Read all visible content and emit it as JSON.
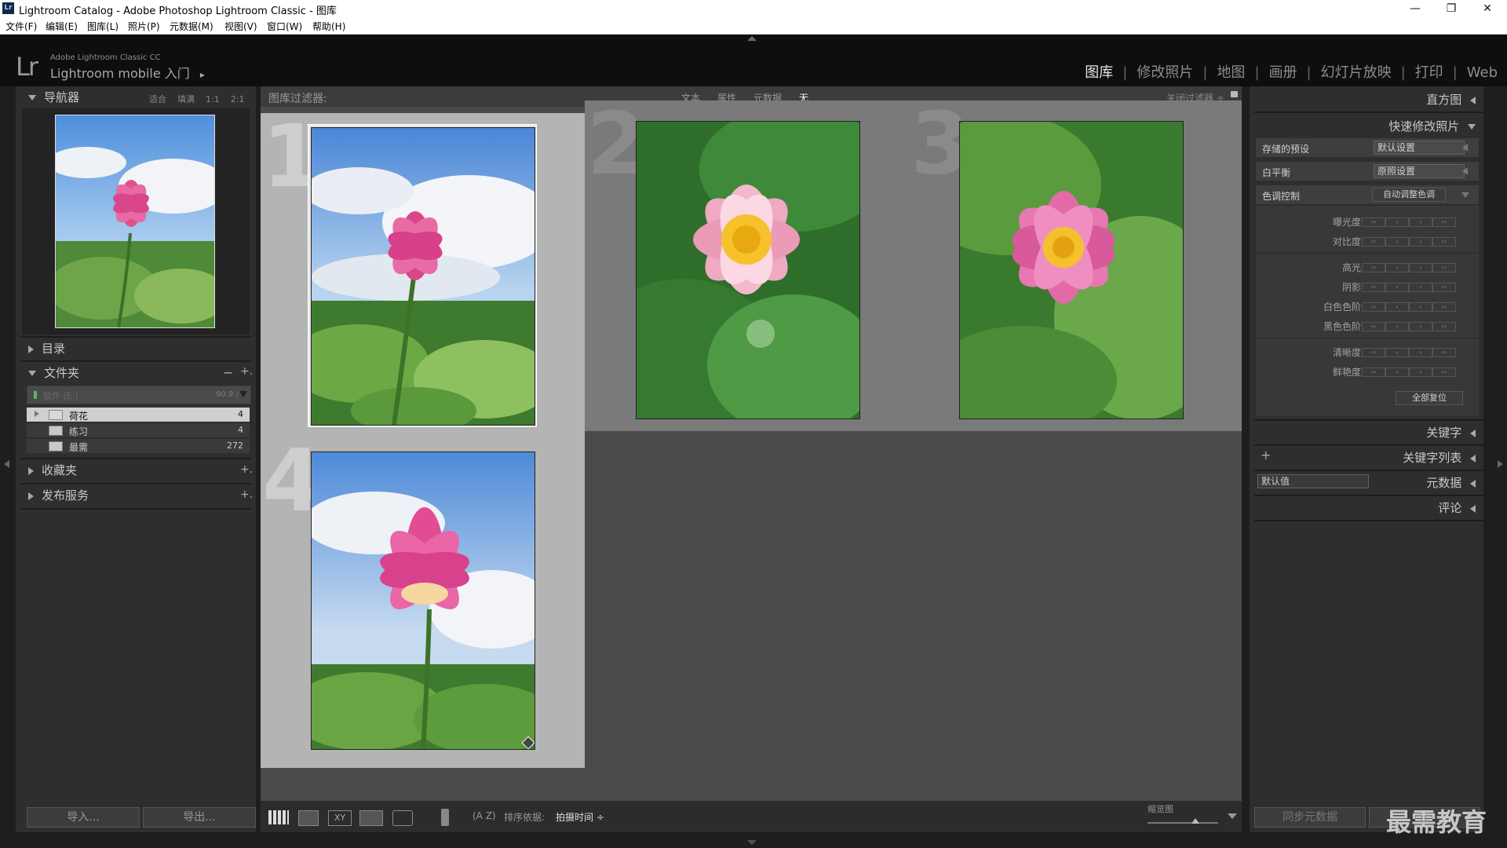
{
  "window": {
    "title": "Lightroom Catalog - Adobe Photoshop Lightroom Classic - 图库",
    "app_badge": "Lr",
    "minimize": "—",
    "restore": "❐",
    "close": "✕"
  },
  "menu": [
    "文件(F)",
    "编辑(E)",
    "图库(L)",
    "照片(P)",
    "元数据(M)",
    "视图(V)",
    "窗口(W)",
    "帮助(H)"
  ],
  "identity": {
    "logo": "Lr",
    "product": "Adobe Lightroom Classic CC",
    "mobile": "Lightroom mobile 入门",
    "arrow": "▸"
  },
  "modules": [
    {
      "label": "图库",
      "active": true
    },
    {
      "label": "修改照片",
      "active": false
    },
    {
      "label": "地图",
      "active": false
    },
    {
      "label": "画册",
      "active": false
    },
    {
      "label": "幻灯片放映",
      "active": false
    },
    {
      "label": "打印",
      "active": false
    },
    {
      "label": "Web",
      "active": false
    }
  ],
  "left": {
    "navigator": {
      "title": "导航器",
      "fit": "适合",
      "fill": "填满",
      "one": "1:1",
      "two": "2:1",
      "updown": "÷"
    },
    "catalog": "目录",
    "folders": {
      "title": "文件夹",
      "minus": "−",
      "plus": "+.",
      "volume": "软件 (E:)",
      "volume_size": "90.9 /",
      "items": [
        {
          "name": "荷花",
          "count": "4",
          "selected": true
        },
        {
          "name": "练习",
          "count": "4",
          "selected": false
        },
        {
          "name": "最需",
          "count": "272",
          "selected": false
        }
      ]
    },
    "collections": "收藏夹",
    "publish": "发布服务",
    "import": "导入...",
    "export": "导出..."
  },
  "filterbar": {
    "label": "图库过滤器:",
    "text": "文本",
    "attr": "属性",
    "meta": "元数据",
    "none": "无",
    "close": "关闭过滤器 ÷"
  },
  "cells": [
    {
      "num": "1"
    },
    {
      "num": "2"
    },
    {
      "num": "3"
    },
    {
      "num": "4"
    }
  ],
  "toolbar": {
    "sort_icon": "(A Z)",
    "sort_label": "排序依据:",
    "sort_value": "拍摄时间 ÷",
    "thumb_label": "缩览图"
  },
  "right": {
    "histogram": "直方图",
    "quick_develop": "快速修改照片",
    "saved_preset": "存储的预设",
    "saved_preset_value": "默认设置",
    "white_balance": "白平衡",
    "white_balance_value": "原照设置",
    "tone_control": "色调控制",
    "auto_tone": "自动调整色调",
    "rows": [
      "曝光度",
      "对比度",
      "高光",
      "阴影",
      "白色色阶",
      "黑色色阶",
      "清晰度",
      "鲜艳度"
    ],
    "btn_glyphs": [
      "‹‹",
      "‹",
      "›",
      "››"
    ],
    "reset_all": "全部复位",
    "keywording": "关键字",
    "keyword_list": "关键字列表",
    "keyword_plus": "+",
    "metadata": "元数据",
    "metadata_preset": "默认值",
    "comments": "评论",
    "sync_meta": "同步元数据",
    "watermark": "最需教育"
  }
}
